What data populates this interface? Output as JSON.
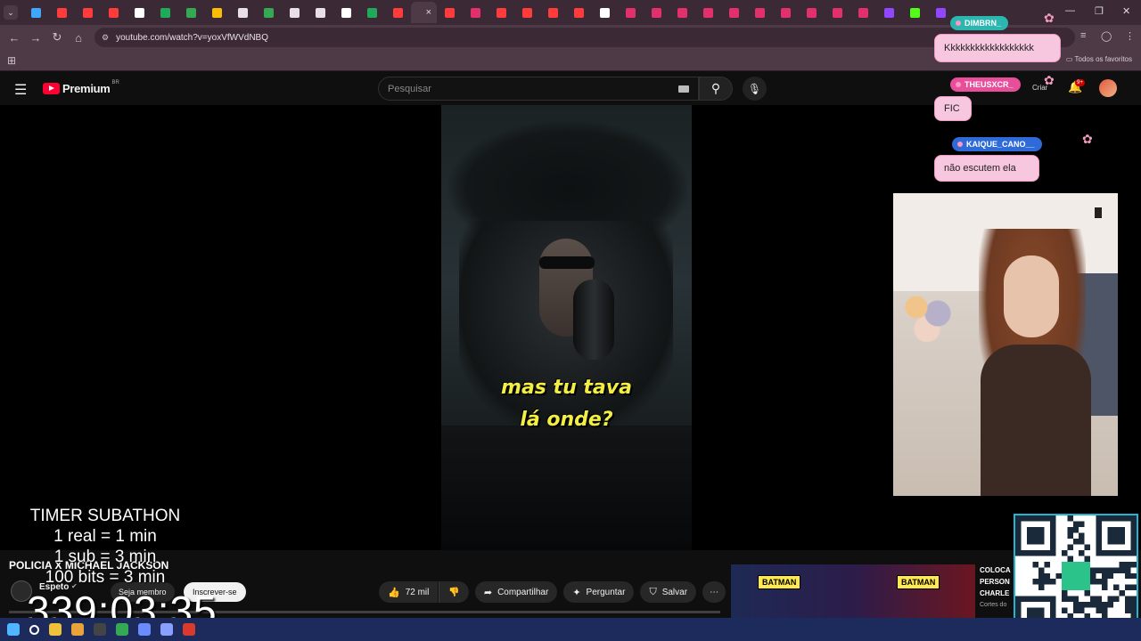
{
  "browser": {
    "tabs": [
      {
        "icon": "gem-icon",
        "color": "#3ea6ff"
      },
      {
        "icon": "youtube-icon",
        "color": "#ff3b3b"
      },
      {
        "icon": "youtube-icon",
        "color": "#ff3b3b"
      },
      {
        "icon": "youtube-icon",
        "color": "#ff3b3b"
      },
      {
        "icon": "s-icon",
        "color": "#ffffff"
      },
      {
        "icon": "sheets-icon",
        "color": "#1faa59"
      },
      {
        "icon": "drive-icon",
        "color": "#34a853"
      },
      {
        "icon": "drive-icon",
        "color": "#fbbc04"
      },
      {
        "icon": "mail-icon",
        "color": "#e8e0e6"
      },
      {
        "icon": "drive-icon",
        "color": "#34a853"
      },
      {
        "icon": "anchor-icon",
        "color": "#e8e0e6"
      },
      {
        "icon": "globe-icon",
        "color": "#e8e0e6"
      },
      {
        "icon": "chatgpt-icon",
        "color": "#ffffff"
      },
      {
        "icon": "code-icon",
        "color": "#1faa59"
      },
      {
        "icon": "youtube-icon",
        "color": "#ff3b3b"
      },
      {
        "icon": "youtube-icon",
        "color": "#ff3b3b",
        "active": true
      },
      {
        "icon": "youtube-icon",
        "color": "#ff3b3b"
      },
      {
        "icon": "instagram-icon",
        "color": "#e1306c"
      },
      {
        "icon": "youtube-icon",
        "color": "#ff3b3b"
      },
      {
        "icon": "youtube-icon",
        "color": "#ff3b3b"
      },
      {
        "icon": "youtube-icon",
        "color": "#ff3b3b"
      },
      {
        "icon": "youtube-icon",
        "color": "#ff3b3b"
      },
      {
        "icon": "tiktok-icon",
        "color": "#ffffff"
      },
      {
        "icon": "instagram-icon",
        "color": "#e1306c"
      },
      {
        "icon": "instagram-icon",
        "color": "#e1306c"
      },
      {
        "icon": "instagram-icon",
        "color": "#e1306c"
      },
      {
        "icon": "instagram-icon",
        "color": "#e1306c"
      },
      {
        "icon": "instagram-icon",
        "color": "#e1306c"
      },
      {
        "icon": "instagram-icon",
        "color": "#e1306c"
      },
      {
        "icon": "instagram-icon",
        "color": "#e1306c"
      },
      {
        "icon": "instagram-icon",
        "color": "#e1306c"
      },
      {
        "icon": "instagram-icon",
        "color": "#e1306c"
      },
      {
        "icon": "instagram-icon",
        "color": "#e1306c"
      },
      {
        "icon": "twitch-icon",
        "color": "#9146ff"
      },
      {
        "icon": "kick-icon",
        "color": "#53fc18"
      },
      {
        "icon": "twitch-icon",
        "color": "#9146ff"
      }
    ],
    "active_tab_close": "×",
    "url": "youtube.com/watch?v=yoxVfWVdNBQ",
    "all_favorites": "Todos os favoritos",
    "tabstrip_color": "#3b2a35",
    "toolbar_color": "#4e3a47"
  },
  "youtube": {
    "brand": "Premium",
    "region": "BR",
    "search_placeholder": "Pesquisar",
    "create_label": "Criar",
    "notification_count": "9+",
    "caption_line1": "mas tu tava",
    "caption_line2": "lá onde?",
    "caption_color": "#f3ee43",
    "video_title": "POLICIA X MICHAEL JACKSON",
    "channel_name": "Espeto",
    "member_label": "Seja membro",
    "subscribe_label": "Inscrever-se",
    "like_count": "72 mil",
    "share_label": "Compartilhar",
    "ask_label": "Perguntar",
    "save_label": "Salvar",
    "reco_title_lines": [
      "COLOCA",
      "PERSON",
      "CHARLE"
    ],
    "reco_meta": "Cortes do",
    "reco_badges": [
      "BATMAN",
      "BATMAN"
    ]
  },
  "chat": [
    {
      "user": "DIMBRN_",
      "message": "Kkkkkkkkkkkkkkkkkk",
      "name_color": "#2bb7b0"
    },
    {
      "user": "THEUSXCR_",
      "message": "FIC",
      "name_color": "#e84f9a"
    },
    {
      "user": "KAIQUE_CANO__",
      "message": "não escutem ela",
      "name_color": "#2f6bd8"
    }
  ],
  "timer": {
    "title": "TIMER SUBATHON",
    "rules": [
      "1 real = 1 min",
      "1 sub = 3 min",
      "100 bits = 3 min"
    ],
    "countdown": "339:03:35"
  },
  "taskbar": {
    "color": "#1d2b5c",
    "icons": [
      "windows-icon",
      "search-icon",
      "chrome-icon",
      "explorer-icon",
      "obs-icon",
      "drive-icon",
      "app-icon",
      "app-icon",
      "chrome-icon"
    ]
  }
}
